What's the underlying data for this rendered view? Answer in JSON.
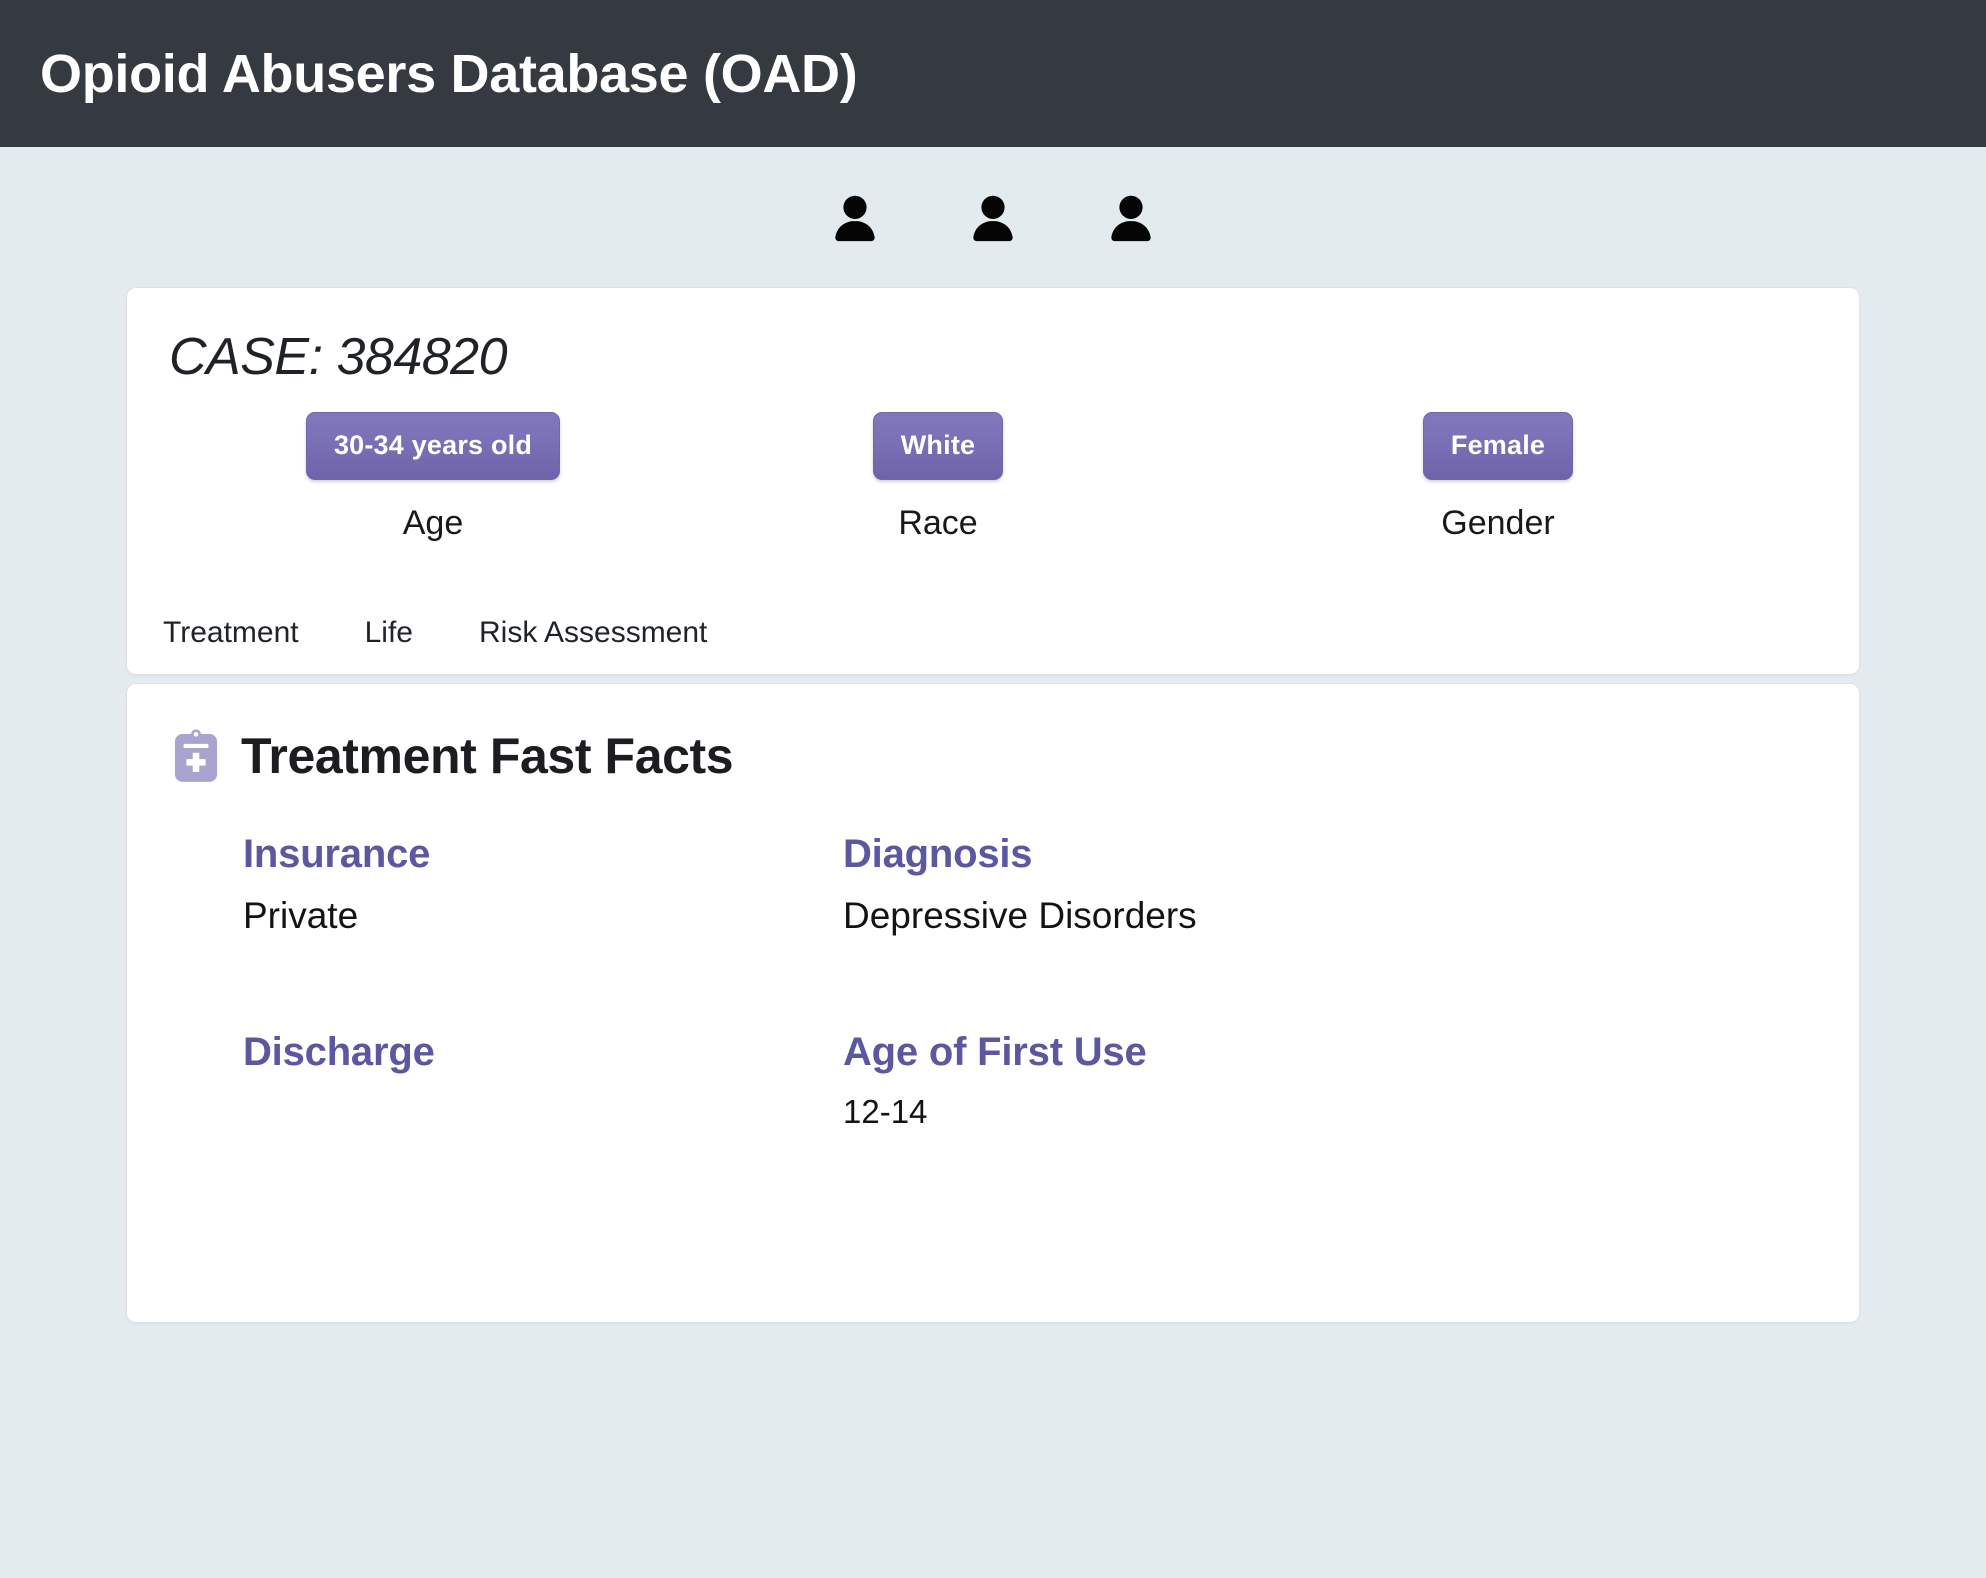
{
  "app": {
    "title": "Opioid Abusers Database (OAD)",
    "header_bg": "#343a40",
    "page_bg": "#e4ebee",
    "accent": "#5c58a0",
    "pill_color": "#7a70b5"
  },
  "avatars": [
    {
      "icon": "person-icon"
    },
    {
      "icon": "person-icon"
    },
    {
      "icon": "person-icon"
    }
  ],
  "case": {
    "title": "CASE: 384820",
    "demographics": [
      {
        "value": "30-34 years old",
        "label": "Age"
      },
      {
        "value": "White",
        "label": "Race"
      },
      {
        "value": "Female",
        "label": "Gender"
      }
    ]
  },
  "tabs": [
    {
      "label": "Treatment"
    },
    {
      "label": "Life"
    },
    {
      "label": "Risk Assessment"
    }
  ],
  "facts": {
    "icon": "clipboard-medical-icon",
    "title": "Treatment Fast Facts",
    "items": [
      {
        "label": "Insurance",
        "value": "Private"
      },
      {
        "label": "Diagnosis",
        "value": "Depressive Disorders"
      },
      {
        "label": "Discharge",
        "value": ""
      },
      {
        "label": "Age of First Use",
        "value": "12-14"
      }
    ]
  }
}
